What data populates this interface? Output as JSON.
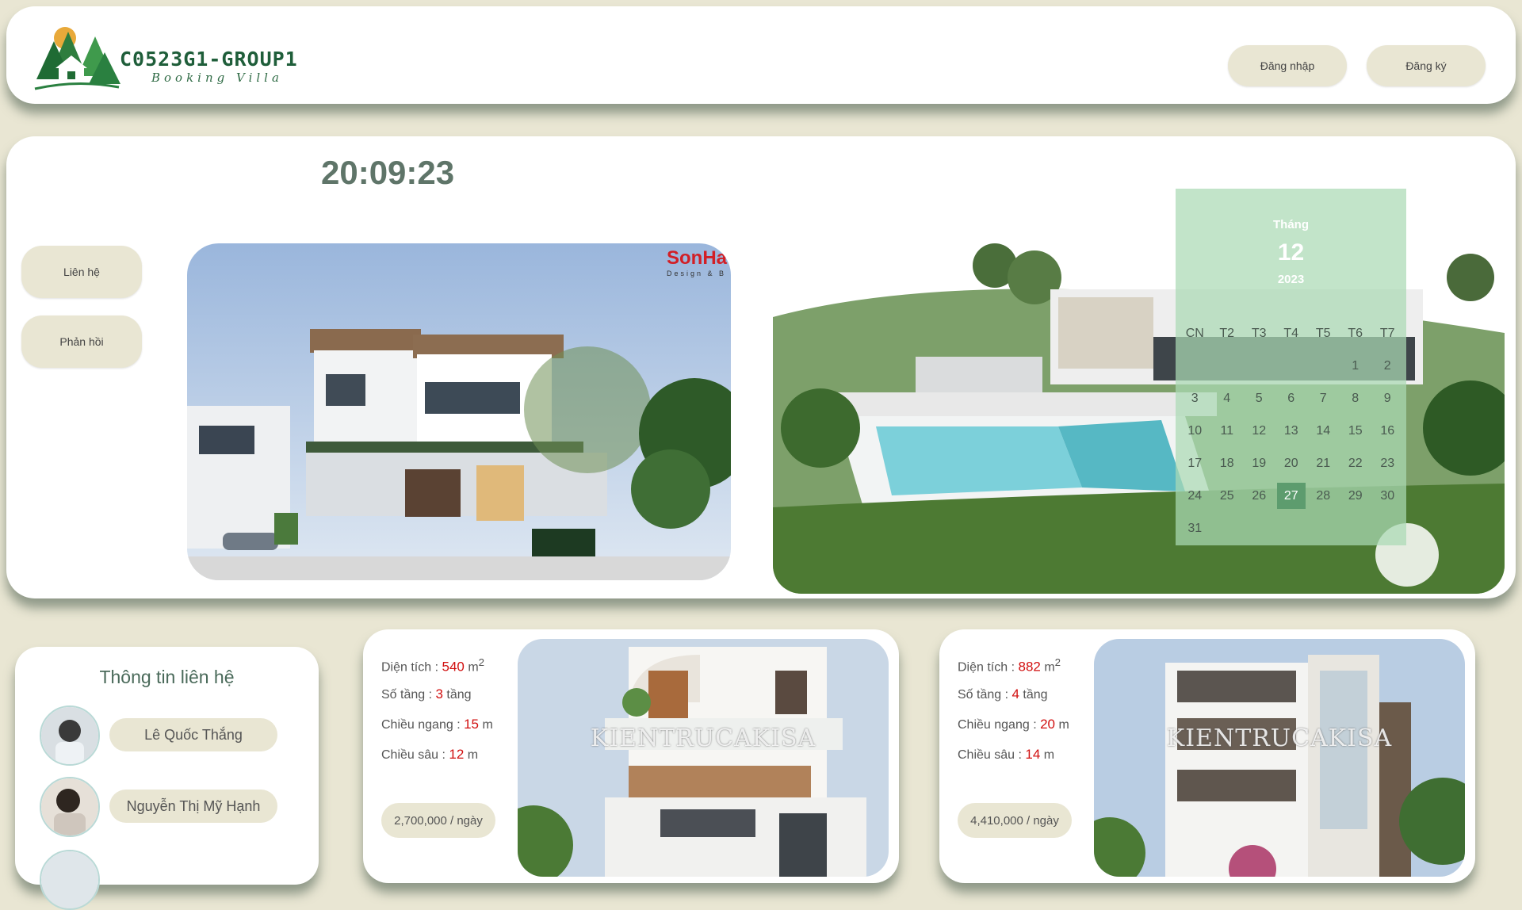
{
  "header": {
    "brand": "C0523G1-GROUP1",
    "tagline": "Booking Villa",
    "login_label": "Đăng nhập",
    "register_label": "Đăng ký"
  },
  "hero": {
    "clock": "20:09:23",
    "contact_label": "Liên hệ",
    "feedback_label": "Phản hồi",
    "watermark_main": "SonHa",
    "watermark_sub": "Design & B"
  },
  "calendar": {
    "month_label": "Tháng",
    "month": "12",
    "year": "2023",
    "weekdays": [
      "CN",
      "T2",
      "T3",
      "T4",
      "T5",
      "T6",
      "T7"
    ],
    "leading_blanks": 5,
    "days_in_month": 31,
    "today": 27
  },
  "contact": {
    "title": "Thông tin liên hệ",
    "people": [
      "Lê Quốc Thắng",
      "Nguyễn Thị Mỹ Hạnh"
    ]
  },
  "villas": [
    {
      "area_label": "Diện tích : ",
      "area": "540",
      "area_unit": "m",
      "floors_label": "Số tầng : ",
      "floors": "3",
      "floors_unit": " tầng",
      "width_label": "Chiều ngang : ",
      "width": "15",
      "width_unit": " m",
      "depth_label": "Chiều sâu : ",
      "depth": "12",
      "depth_unit": " m",
      "price": "2,700,000 / ngày",
      "watermark": "KIENTRUCAKISA"
    },
    {
      "area_label": "Diện tích : ",
      "area": "882",
      "area_unit": "m",
      "floors_label": "Số tầng : ",
      "floors": "4",
      "floors_unit": " tầng",
      "width_label": "Chiều ngang : ",
      "width": "20",
      "width_unit": " m",
      "depth_label": "Chiều sâu : ",
      "depth": "14",
      "depth_unit": " m",
      "price": "4,410,000 / ngày",
      "watermark": "KIENTRUCAKISA"
    }
  ],
  "colors": {
    "background": "#e9e6d3",
    "brand": "#1f5e3a",
    "calendar_overlay": "#aadab4",
    "today": "#5d9c6e",
    "value_red": "#d10f0f"
  }
}
